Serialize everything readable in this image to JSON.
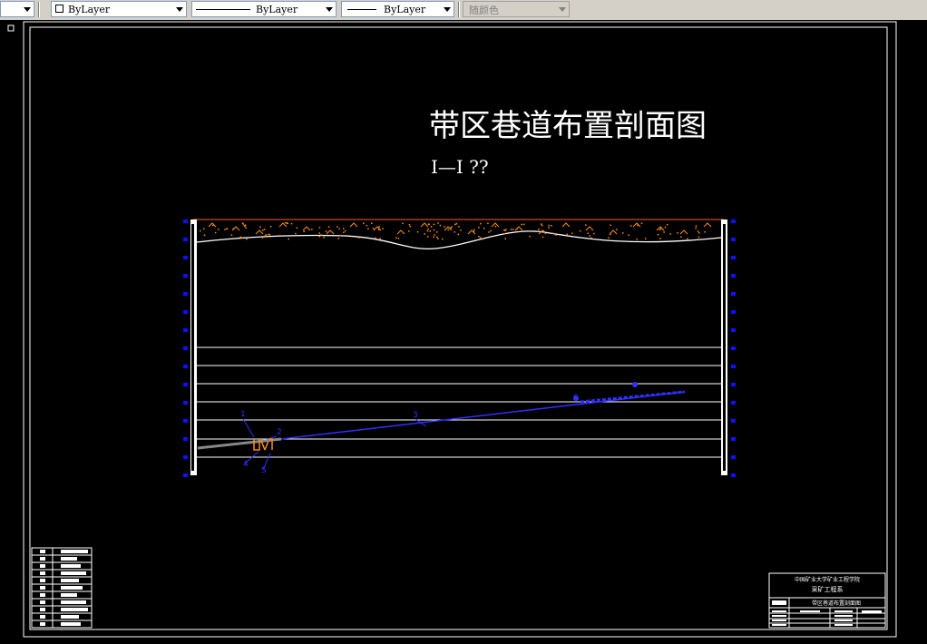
{
  "toolbar": {
    "color_control": {
      "value": "ByLayer"
    },
    "linetype_control": {
      "value": "ByLayer"
    },
    "lineweight_control": {
      "value": "ByLayer"
    },
    "plotstyle_control": {
      "value": "随颜色"
    }
  },
  "drawing": {
    "title": "带区巷道布置剖面图",
    "section_label": "I—I ??",
    "labels": {
      "a": "1",
      "b": "2",
      "c": "3",
      "d": "4",
      "e": "5",
      "f": "6"
    },
    "title_block": {
      "school": "中国矿业大学矿业工程学院",
      "major": "采矿工程系",
      "drawing_name": "带区巷道布置剖面图"
    }
  },
  "colors": {
    "background": "#000000",
    "lines": "#ffffff",
    "blue": "#0000ff",
    "orange": "#ff8c1a",
    "gray": "#808080"
  }
}
